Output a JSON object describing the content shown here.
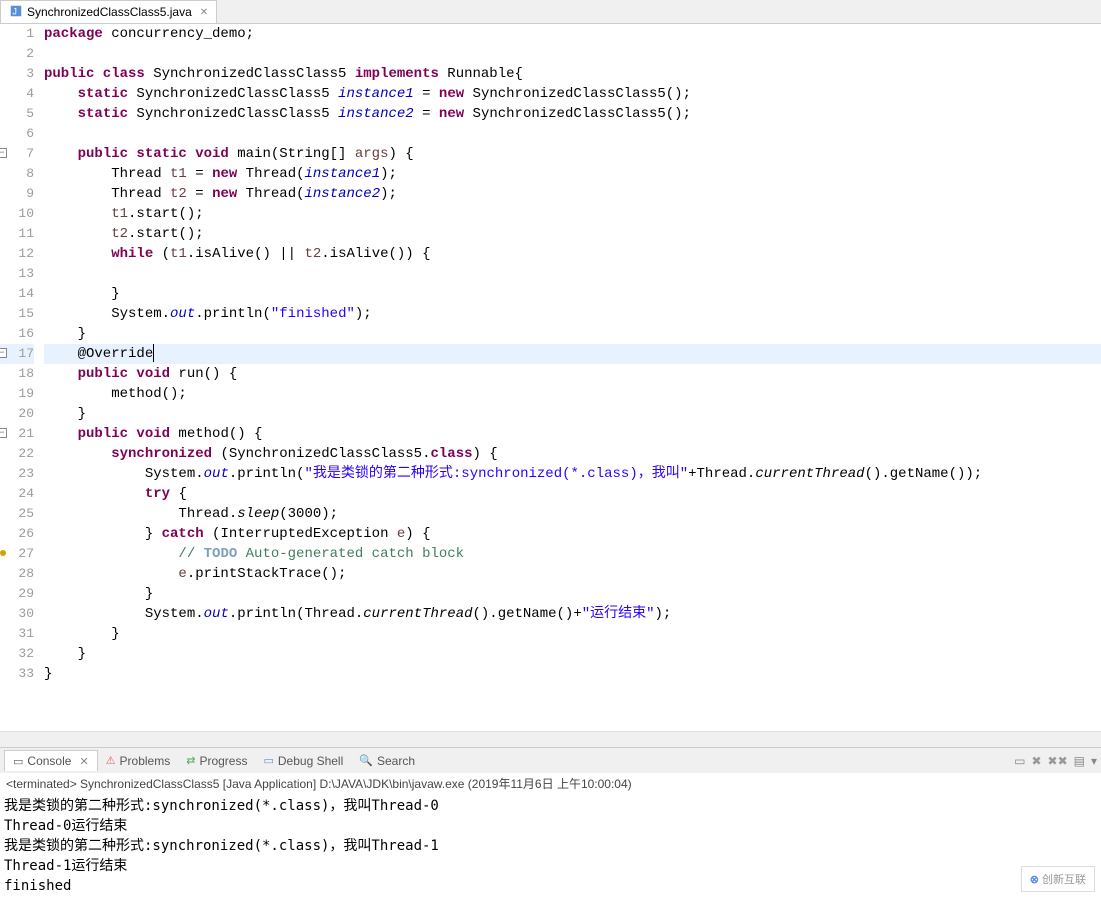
{
  "tab": {
    "filename": "SynchronizedClassClass5.java"
  },
  "code": {
    "lines": [
      {
        "n": 1,
        "tokens": [
          [
            "kw",
            "package"
          ],
          [
            "",
            " concurrency_demo;"
          ]
        ]
      },
      {
        "n": 2,
        "tokens": []
      },
      {
        "n": 3,
        "tokens": [
          [
            "kw",
            "public class"
          ],
          [
            "",
            " SynchronizedClassClass5 "
          ],
          [
            "kw",
            "implements"
          ],
          [
            "",
            " Runnable{"
          ]
        ]
      },
      {
        "n": 4,
        "tokens": [
          [
            "",
            "    "
          ],
          [
            "kw",
            "static"
          ],
          [
            "",
            " SynchronizedClassClass5 "
          ],
          [
            "static-it",
            "instance1"
          ],
          [
            "",
            " = "
          ],
          [
            "kw",
            "new"
          ],
          [
            "",
            " SynchronizedClassClass5();"
          ]
        ]
      },
      {
        "n": 5,
        "tokens": [
          [
            "",
            "    "
          ],
          [
            "kw",
            "static"
          ],
          [
            "",
            " SynchronizedClassClass5 "
          ],
          [
            "static-it",
            "instance2"
          ],
          [
            "",
            " = "
          ],
          [
            "kw",
            "new"
          ],
          [
            "",
            " SynchronizedClassClass5();"
          ]
        ]
      },
      {
        "n": 6,
        "tokens": []
      },
      {
        "n": 7,
        "minus": true,
        "tokens": [
          [
            "",
            "    "
          ],
          [
            "kw",
            "public static void"
          ],
          [
            "",
            " main(String[] "
          ],
          [
            "var2",
            "args"
          ],
          [
            "",
            ") {"
          ]
        ]
      },
      {
        "n": 8,
        "tokens": [
          [
            "",
            "        Thread "
          ],
          [
            "var2",
            "t1"
          ],
          [
            "",
            " = "
          ],
          [
            "kw",
            "new"
          ],
          [
            "",
            " Thread("
          ],
          [
            "static-it",
            "instance1"
          ],
          [
            "",
            ");"
          ]
        ]
      },
      {
        "n": 9,
        "tokens": [
          [
            "",
            "        Thread "
          ],
          [
            "var2",
            "t2"
          ],
          [
            "",
            " = "
          ],
          [
            "kw",
            "new"
          ],
          [
            "",
            " Thread("
          ],
          [
            "static-it",
            "instance2"
          ],
          [
            "",
            ");"
          ]
        ]
      },
      {
        "n": 10,
        "tokens": [
          [
            "",
            "        "
          ],
          [
            "var2",
            "t1"
          ],
          [
            "",
            ".start();"
          ]
        ]
      },
      {
        "n": 11,
        "tokens": [
          [
            "",
            "        "
          ],
          [
            "var2",
            "t2"
          ],
          [
            "",
            ".start();"
          ]
        ]
      },
      {
        "n": 12,
        "tokens": [
          [
            "",
            "        "
          ],
          [
            "kw",
            "while"
          ],
          [
            "",
            " ("
          ],
          [
            "var2",
            "t1"
          ],
          [
            "",
            ".isAlive() || "
          ],
          [
            "var2",
            "t2"
          ],
          [
            "",
            ".isAlive()) {"
          ]
        ]
      },
      {
        "n": 13,
        "tokens": []
      },
      {
        "n": 14,
        "tokens": [
          [
            "",
            "        }"
          ]
        ]
      },
      {
        "n": 15,
        "tokens": [
          [
            "",
            "        System."
          ],
          [
            "static-it",
            "out"
          ],
          [
            "",
            ".println("
          ],
          [
            "str",
            "\"finished\""
          ],
          [
            "",
            ");"
          ]
        ]
      },
      {
        "n": 16,
        "tokens": [
          [
            "",
            "    }"
          ]
        ]
      },
      {
        "n": 17,
        "minus": true,
        "hl": true,
        "caret": true,
        "tokens": [
          [
            "",
            "    @Override"
          ]
        ]
      },
      {
        "n": 18,
        "tokens": [
          [
            "",
            "    "
          ],
          [
            "kw",
            "public void"
          ],
          [
            "",
            " run() {"
          ]
        ]
      },
      {
        "n": 19,
        "tokens": [
          [
            "",
            "        method();"
          ]
        ]
      },
      {
        "n": 20,
        "tokens": [
          [
            "",
            "    }"
          ]
        ]
      },
      {
        "n": 21,
        "minus": true,
        "tokens": [
          [
            "",
            "    "
          ],
          [
            "kw",
            "public void"
          ],
          [
            "",
            " method() {"
          ]
        ]
      },
      {
        "n": 22,
        "tokens": [
          [
            "",
            "        "
          ],
          [
            "kw",
            "synchronized"
          ],
          [
            "",
            " (SynchronizedClassClass5."
          ],
          [
            "kw",
            "class"
          ],
          [
            "",
            ") {"
          ]
        ]
      },
      {
        "n": 23,
        "tokens": [
          [
            "",
            "            System."
          ],
          [
            "static-it",
            "out"
          ],
          [
            "",
            ".println("
          ],
          [
            "str",
            "\"我是类锁的第二种形式:synchronized(*.class)，我叫\""
          ],
          [
            "",
            "+Thread."
          ],
          [
            "method-it",
            "currentThread"
          ],
          [
            "",
            "().getName());"
          ]
        ]
      },
      {
        "n": 24,
        "tokens": [
          [
            "",
            "            "
          ],
          [
            "kw",
            "try"
          ],
          [
            "",
            " {"
          ]
        ]
      },
      {
        "n": 25,
        "tokens": [
          [
            "",
            "                Thread."
          ],
          [
            "method-it",
            "sleep"
          ],
          [
            "",
            "(3000);"
          ]
        ]
      },
      {
        "n": 26,
        "tokens": [
          [
            "",
            "            } "
          ],
          [
            "kw",
            "catch"
          ],
          [
            "",
            " (InterruptedException "
          ],
          [
            "var2",
            "e"
          ],
          [
            "",
            ") {"
          ]
        ]
      },
      {
        "n": 27,
        "dot": true,
        "tokens": [
          [
            "",
            "                "
          ],
          [
            "cmt",
            "// "
          ],
          [
            "todo",
            "TODO"
          ],
          [
            "cmt",
            " Auto-generated catch block"
          ]
        ]
      },
      {
        "n": 28,
        "tokens": [
          [
            "",
            "                "
          ],
          [
            "var2",
            "e"
          ],
          [
            "",
            ".printStackTrace();"
          ]
        ]
      },
      {
        "n": 29,
        "tokens": [
          [
            "",
            "            }"
          ]
        ]
      },
      {
        "n": 30,
        "tokens": [
          [
            "",
            "            System."
          ],
          [
            "static-it",
            "out"
          ],
          [
            "",
            ".println(Thread."
          ],
          [
            "method-it",
            "currentThread"
          ],
          [
            "",
            "().getName()+"
          ],
          [
            "str",
            "\"运行结束\""
          ],
          [
            "",
            ");"
          ]
        ]
      },
      {
        "n": 31,
        "tokens": [
          [
            "",
            "        }"
          ]
        ]
      },
      {
        "n": 32,
        "tokens": [
          [
            "",
            "    }"
          ]
        ]
      },
      {
        "n": 33,
        "tokens": [
          [
            "",
            "}"
          ]
        ]
      }
    ]
  },
  "bottom": {
    "tabs": [
      {
        "label": "Console",
        "active": true
      },
      {
        "label": "Problems"
      },
      {
        "label": "Progress"
      },
      {
        "label": "Debug Shell"
      },
      {
        "label": "Search"
      }
    ]
  },
  "console": {
    "status": "<terminated> SynchronizedClassClass5 [Java Application] D:\\JAVA\\JDK\\bin\\javaw.exe (2019年11月6日 上午10:00:04)",
    "lines": [
      "我是类锁的第二种形式:synchronized(*.class)，我叫Thread-0",
      "Thread-0运行结束",
      "我是类锁的第二种形式:synchronized(*.class)，我叫Thread-1",
      "Thread-1运行结束",
      "finished"
    ]
  },
  "watermark": "创新互联"
}
